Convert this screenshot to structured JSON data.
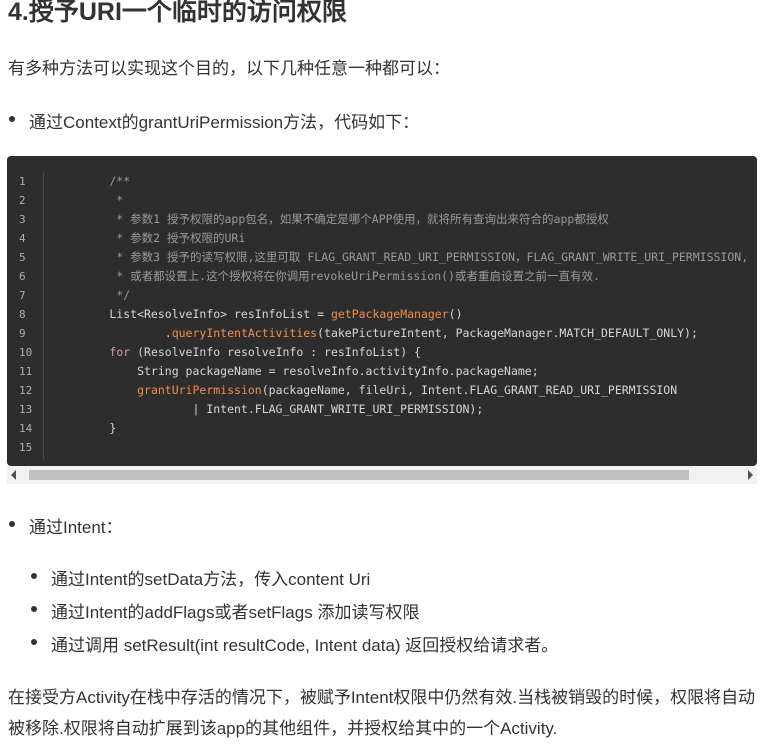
{
  "heading": "4.授予URI一个临时的访问权限",
  "intro": "有多种方法可以实现这个目的，以下几种任意一种都可以：",
  "bullet1": "通过Context的grantUriPermission方法，代码如下：",
  "code": {
    "line_numbers": [
      "1",
      "2",
      "3",
      "4",
      "5",
      "6",
      "7",
      "8",
      "9",
      "10",
      "11",
      "12",
      "13",
      "14",
      "15"
    ],
    "lines": [
      "        /**",
      "         *",
      "         * 参数1 授予权限的app包名，如果不确定是哪个APP使用，就将所有查询出来符合的app都授权",
      "         * 参数2 授予权限的URi",
      "         * 参数3 授予的读写权限,这里可取 FLAG_GRANT_READ_URI_PERMISSION，FLAG_GRANT_WRITE_URI_PERMISSION,",
      "         * 或者都设置上.这个授权将在你调用revokeUriPermission()或者重启设置之前一直有效.",
      "         */",
      "        List<ResolveInfo> resInfoList = getPackageManager()",
      "                .queryIntentActivities(takePictureIntent, PackageManager.MATCH_DEFAULT_ONLY);",
      "        for (ResolveInfo resolveInfo : resInfoList) {",
      "            String packageName = resolveInfo.activityInfo.packageName;",
      "            grantUriPermission(packageName, fileUri, Intent.FLAG_GRANT_READ_URI_PERMISSION",
      "                    | Intent.FLAG_GRANT_WRITE_URI_PERMISSION);",
      "        }",
      ""
    ]
  },
  "bullet2": "通过Intent：",
  "sub_bullets": [
    "通过Intent的setData方法，传入content Uri",
    "通过Intent的addFlags或者setFlags 添加读写权限",
    "通过调用 setResult(int resultCode, Intent data) 返回授权给请求者。"
  ],
  "closing": "在接受方Activity在栈中存活的情况下，被赋予Intent权限中仍然有效.当栈被销毁的时候，权限将自动被移除.权限将自动扩展到该app的其他组件，并授权给其中的一个Activity.",
  "colors": {
    "code_bg": "#2d2d2d",
    "comment": "#9a9a9a",
    "keyword": "#cc99cd",
    "function": "#f08d49"
  }
}
